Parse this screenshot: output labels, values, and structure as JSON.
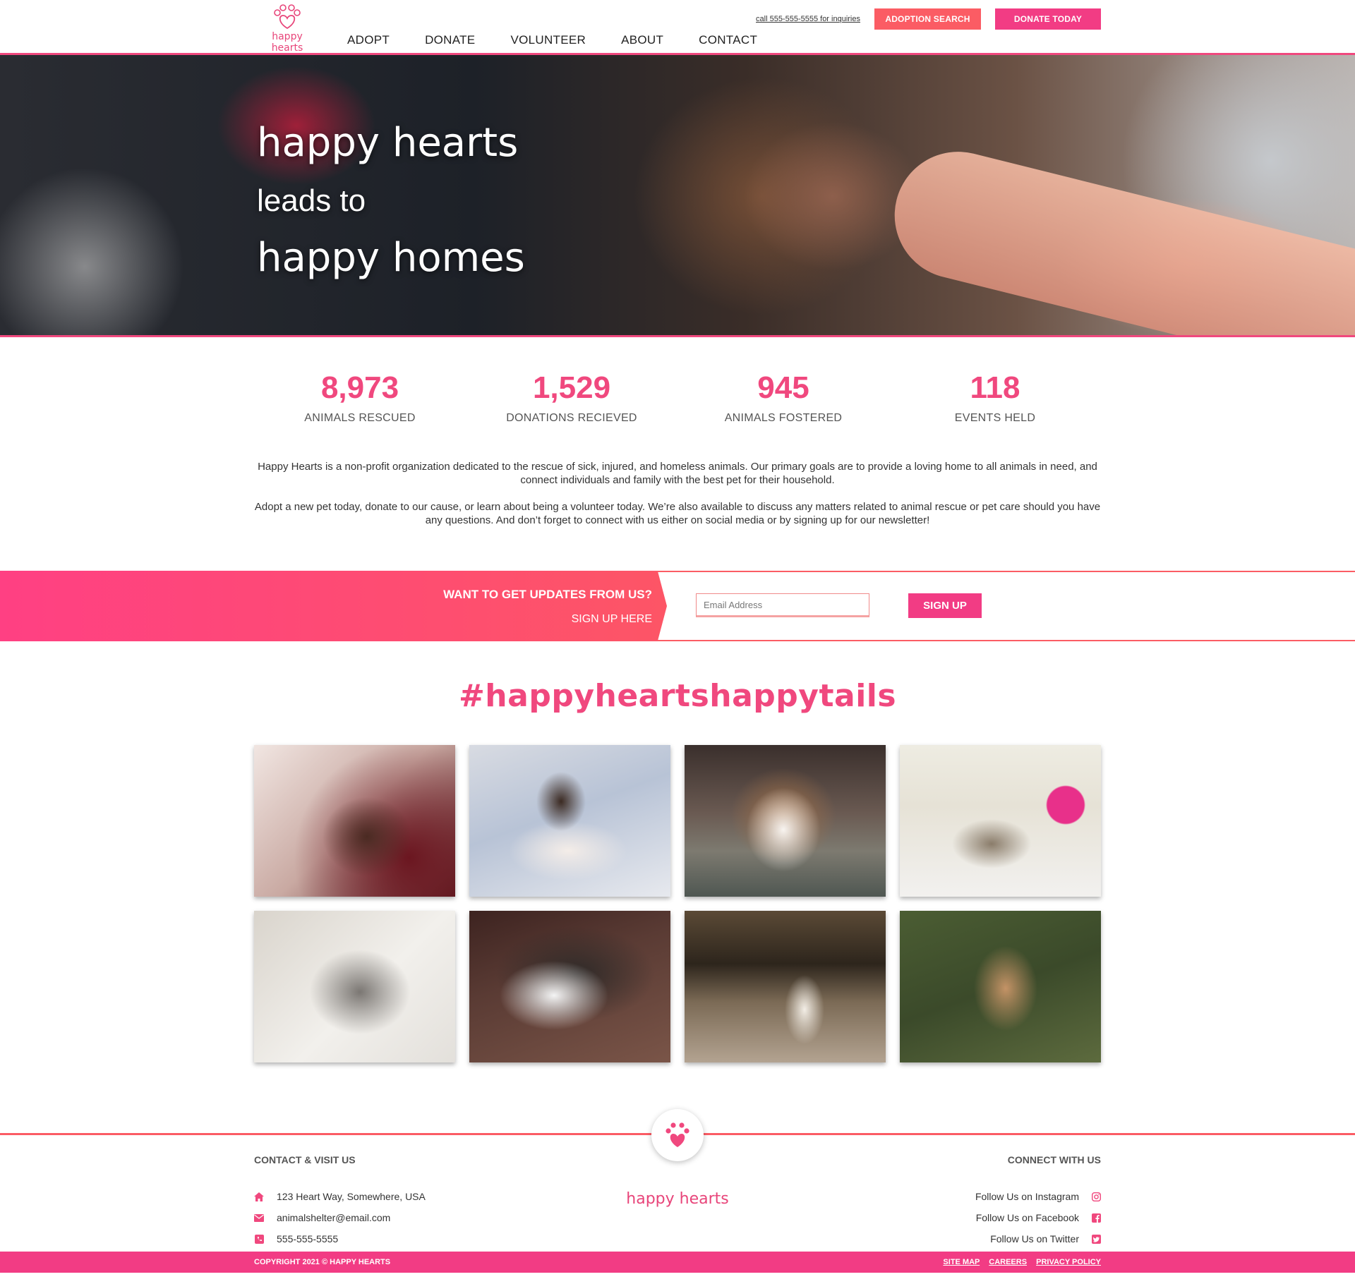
{
  "brand": {
    "name": "happy hearts",
    "accent": "#f0487e",
    "accent_pink": "#f23c84",
    "accent_coral": "#fb5c64"
  },
  "header": {
    "phone_link": "call 555-555-5555 for inquiries",
    "adoption_search": "ADOPTION SEARCH",
    "donate_today": "DONATE TODAY",
    "nav": [
      "ADOPT",
      "DONATE",
      "VOLUNTEER",
      "ABOUT",
      "CONTACT"
    ]
  },
  "hero": {
    "line1": "happy hearts",
    "line2": "leads to",
    "line3": "happy homes"
  },
  "stats": [
    {
      "value": "8,973",
      "label": "ANIMALS RESCUED"
    },
    {
      "value": "1,529",
      "label": "DONATIONS RECIEVED"
    },
    {
      "value": "945",
      "label": "ANIMALS FOSTERED"
    },
    {
      "value": "118",
      "label": "EVENTS HELD"
    }
  ],
  "intro": {
    "p1": "Happy Hearts is a non-profit organization dedicated to the rescue of sick, injured, and homeless animals. Our primary goals are to provide a loving home to all animals in need, and connect individuals and family with the best pet for their household.",
    "p2": "Adopt a new pet today, donate to our cause, or learn about being a volunteer today. We’re also available to discuss any matters related to animal rescue or pet care should you have any questions. And don’t forget to connect with us either on social media or by signing up for our newsletter!"
  },
  "newsletter": {
    "question": "WANT TO GET UPDATES FROM US?",
    "subtitle": "SIGN UP HERE",
    "email_placeholder": "Email Address",
    "email_value": "",
    "signup": "SIGN UP"
  },
  "gallery": {
    "hashtag": "#happyheartshappytails",
    "photos": [
      "chihuahua-photo",
      "siamese-cat-photo",
      "pitbull-photo",
      "tabby-kitten-photo",
      "gray-cat-photo",
      "husky-photo",
      "calico-cat-photo",
      "small-dog-photo"
    ]
  },
  "footer": {
    "contact_heading": "CONTACT & VISIT US",
    "address": "123 Heart Way, Somewhere, USA",
    "email": "animalshelter@email.com",
    "phone": "555-555-5555",
    "brand": "happy hearts",
    "connect_heading": "CONNECT WITH US",
    "instagram": "Follow Us on Instagram",
    "facebook": "Follow Us on Facebook",
    "twitter": "Follow Us on Twitter",
    "copyright": "COPYRIGHT 2021 © HAPPY HEARTS",
    "links": [
      "SITE MAP",
      "CAREERS",
      "PRIVACY POLICY"
    ]
  }
}
